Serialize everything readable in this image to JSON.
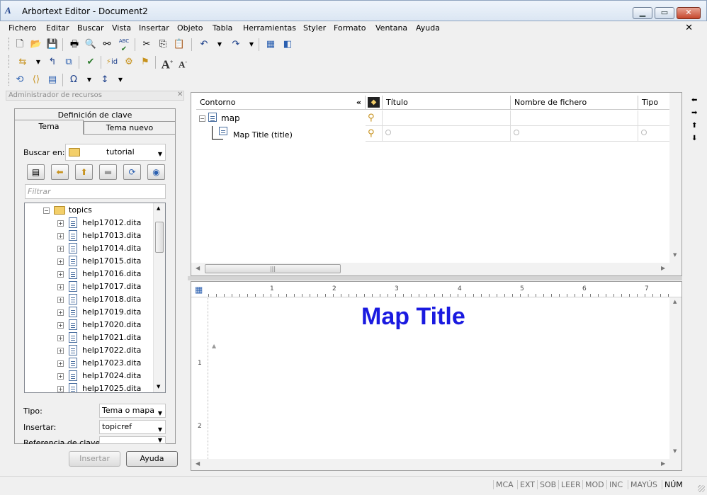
{
  "window": {
    "title": "Arbortext Editor - Document2",
    "app_icon_glyph": "A"
  },
  "menu": [
    "Fichero",
    "Editar",
    "Buscar",
    "Vista",
    "Insertar",
    "Objeto",
    "Tabla",
    "Herramientas",
    "Styler",
    "Formato",
    "Ventana",
    "Ayuda"
  ],
  "toolbar_text": {
    "abc": "ABC",
    "font_larger": "A",
    "font_smaller": "A",
    "omega": "Ω",
    "id": "id"
  },
  "resource_manager": {
    "title": "Administrador de recursos",
    "tabs": {
      "key_def": "Definición de clave",
      "topic": "Tema",
      "new_topic": "Tema nuevo"
    },
    "search_in_label": "Buscar en:",
    "search_in_value": "tutorial",
    "filter_placeholder": "Filtrar",
    "tree_root": "topics",
    "files": [
      "help17012.dita",
      "help17013.dita",
      "help17014.dita",
      "help17015.dita",
      "help17016.dita",
      "help17017.dita",
      "help17018.dita",
      "help17019.dita",
      "help17020.dita",
      "help17021.dita",
      "help17022.dita",
      "help17023.dita",
      "help17024.dita",
      "help17025.dita"
    ],
    "type_label": "Tipo:",
    "type_value": "Tema o mapa",
    "insert_label": "Insertar:",
    "insert_value": "topicref",
    "keyref_label": "Referencia de clave:",
    "insert_button": "Insertar",
    "help_button": "Ayuda"
  },
  "outline": {
    "columns": [
      "Contorno",
      "Título",
      "Nombre de fichero",
      "Tipo"
    ],
    "collapse_glyph": "«",
    "rows": [
      {
        "label": "map"
      },
      {
        "label": "Map Title (title)"
      }
    ]
  },
  "document": {
    "title_text": "Map Title",
    "ruler_numbers": [
      "1",
      "2",
      "3",
      "4",
      "5",
      "6",
      "7"
    ],
    "vruler_numbers": [
      "1",
      "2"
    ]
  },
  "status": [
    "MCA",
    "EXT",
    "SOB",
    "LEER",
    "MOD",
    "INC",
    "MAYÚS",
    "NÚM"
  ],
  "colors": {
    "map_title": "#1a1ae0"
  }
}
